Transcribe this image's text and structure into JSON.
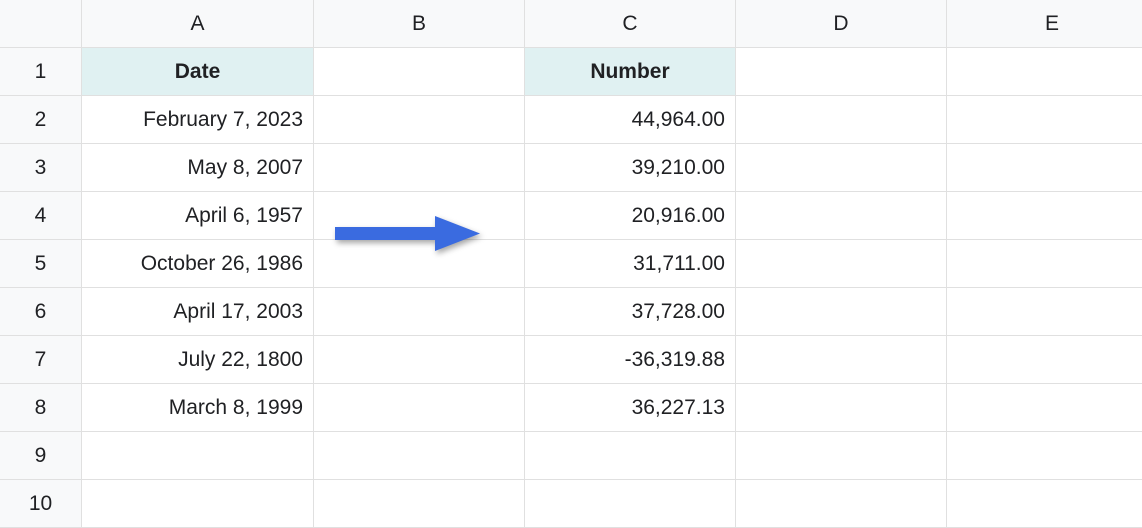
{
  "columns": [
    "A",
    "B",
    "C",
    "D",
    "E"
  ],
  "rows": [
    "1",
    "2",
    "3",
    "4",
    "5",
    "6",
    "7",
    "8",
    "9",
    "10"
  ],
  "headers": {
    "date": "Date",
    "number": "Number"
  },
  "data": {
    "dates": [
      "February 7, 2023",
      "May 8, 2007",
      "April 6, 1957",
      "October 26, 1986",
      "April 17, 2003",
      "July 22, 1800",
      "March 8, 1999"
    ],
    "numbers": [
      "44,964.00",
      "39,210.00",
      "20,916.00",
      "31,711.00",
      "37,728.00",
      "-36,319.88",
      "36,227.13"
    ]
  },
  "colors": {
    "header_bg": "#e0f1f2",
    "grid_bg": "#f8f9fa",
    "border": "#e0e0e0",
    "arrow": "#3a6be0"
  }
}
